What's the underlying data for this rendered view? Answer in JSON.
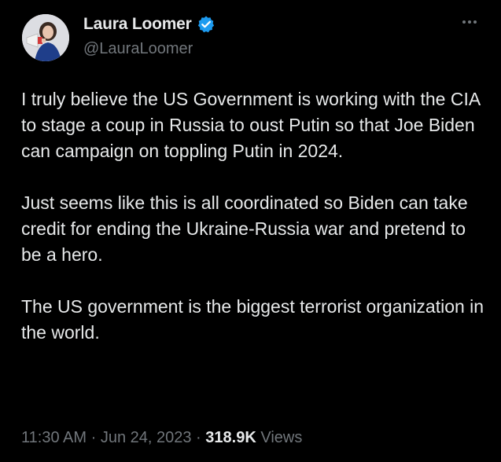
{
  "user": {
    "display_name": "Laura Loomer",
    "handle": "@LauraLoomer",
    "verified_color": "#1d9bf0"
  },
  "tweet": {
    "paragraphs": [
      "I truly believe the US Government is working with the CIA to stage a coup in Russia to oust Putin so that Joe Biden can campaign on toppling Putin in 2024.",
      "Just seems like this is all coordinated so Biden can take credit for ending the Ukraine-Russia war and pretend to be a hero.",
      "The US government is the biggest terrorist organization in the world."
    ]
  },
  "meta": {
    "time": "11:30 AM",
    "separator": "·",
    "date": "Jun 24, 2023",
    "views_count": "318.9K",
    "views_label": "Views"
  },
  "colors": {
    "background": "#000000",
    "primary_text": "#e7e9ea",
    "secondary_text": "#71767b",
    "accent": "#1d9bf0"
  },
  "icons": {
    "verified": "verified-badge-icon",
    "more": "more-options-icon"
  }
}
